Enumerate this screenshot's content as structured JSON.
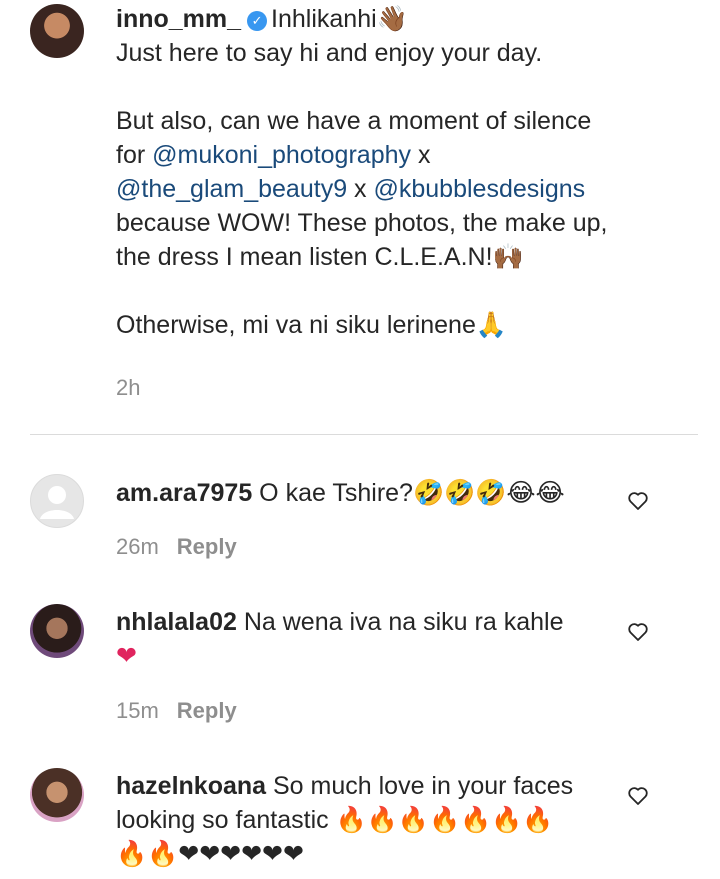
{
  "main_comment": {
    "username": "inno_mm_",
    "verified_icon": "verified-badge-icon",
    "lines": {
      "l1": "Inhlikanhi👋🏾",
      "l2": "Just here to say hi and enjoy your day.",
      "l3": "But also, can we have a moment of silence",
      "l4_pre": "for ",
      "l4_mention": "@mukoni_photography",
      "l4_post": " x",
      "l5_mention1": "@the_glam_beauty9",
      "l5_mid": " x ",
      "l5_mention2": "@kbubblesdesigns",
      "l6": "because WOW! These photos, the make up,",
      "l7": "the dress I mean listen C.L.E.A.N!🙌🏾",
      "l8": "Otherwise, mi va ni siku lerinene🙏"
    },
    "time": "2h"
  },
  "replies": [
    {
      "username": "am.ara7975",
      "text": " O kae Tshire?🤣🤣🤣😂😂",
      "time": "26m",
      "reply_label": "Reply"
    },
    {
      "username": "nhlalala02",
      "text": " Na wena iva na siku ra kahle",
      "text2": "❤",
      "time": "15m",
      "reply_label": "Reply"
    },
    {
      "username": "hazelnkoana",
      "text": " So much love in your faces",
      "text2": "looking so fantastic 🔥🔥🔥🔥🔥🔥🔥",
      "text3": "🔥🔥❤❤❤❤❤❤"
    }
  ],
  "icons": {
    "like": "heart-outline-icon",
    "default_avatar": "default-avatar-icon"
  }
}
